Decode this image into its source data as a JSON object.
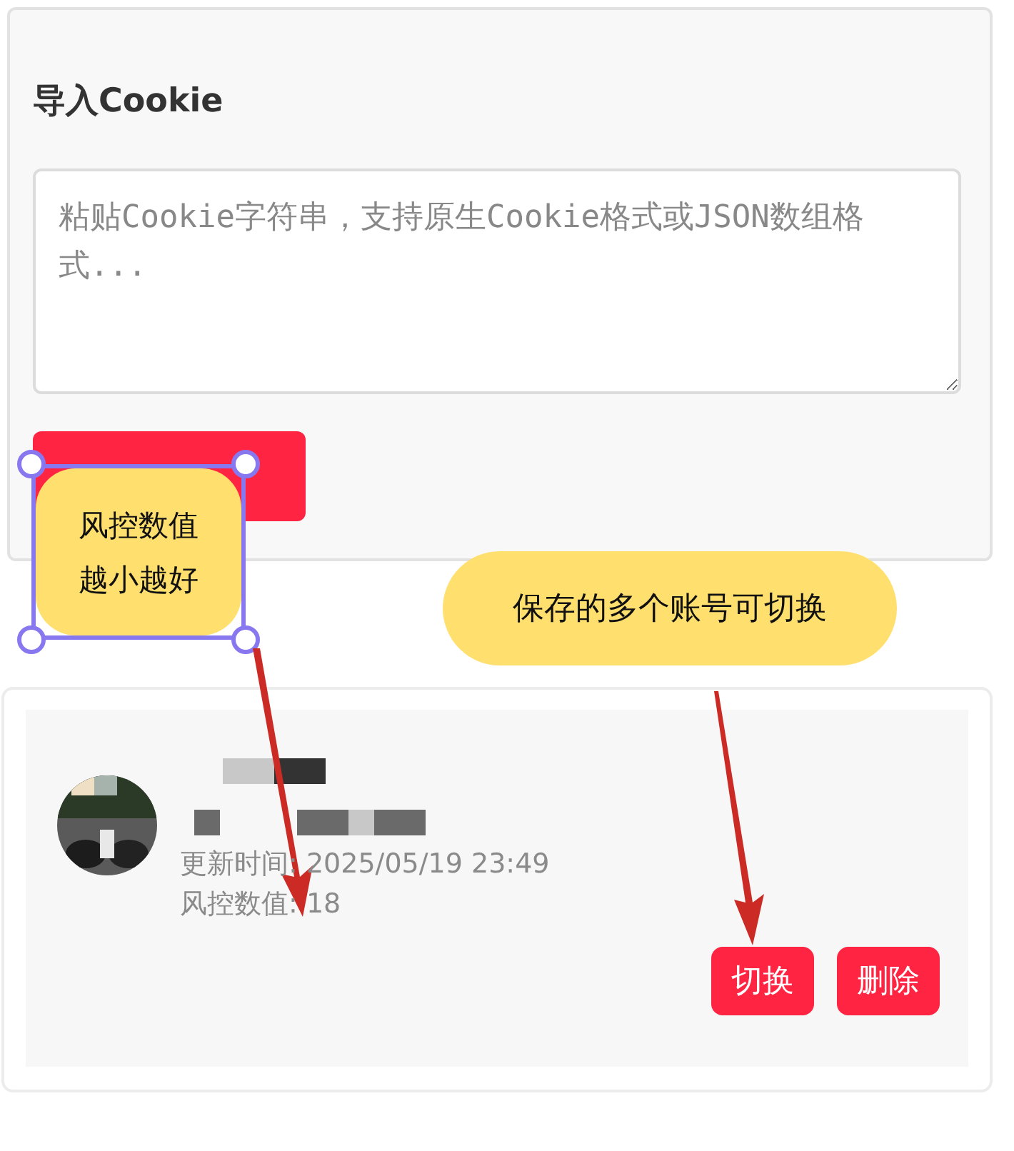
{
  "import_panel": {
    "title": "导入Cookie",
    "cookie_input": {
      "placeholder": "粘贴Cookie字符串，支持原生Cookie格式或JSON数组格式..."
    }
  },
  "accounts": [
    {
      "updated": "更新时间: 2025/05/19 23:49",
      "risk": "风控数值: 18",
      "actions": [
        "切换",
        "删除"
      ]
    }
  ],
  "annotations": [
    {
      "text": "风控数值越小越好",
      "kind": "selected-note"
    },
    {
      "text": "保存的多个账号可切换",
      "kind": "pill"
    }
  ]
}
